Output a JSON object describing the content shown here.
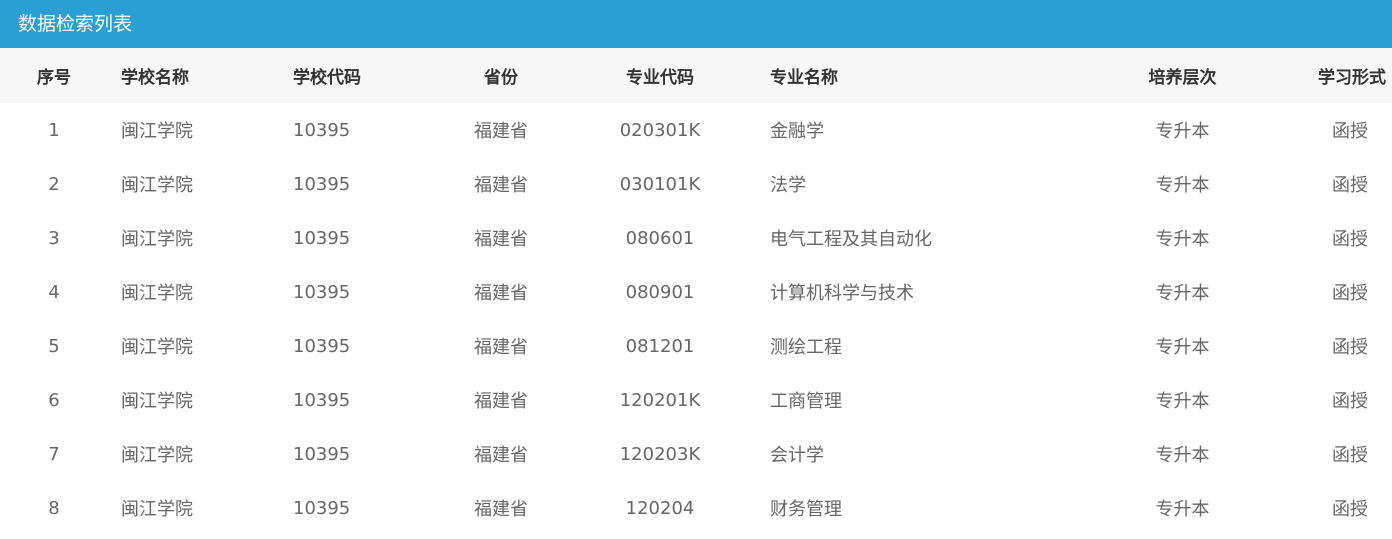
{
  "panel": {
    "title": "数据检索列表"
  },
  "table": {
    "headers": {
      "index": "序号",
      "school_name": "学校名称",
      "school_code": "学校代码",
      "province": "省份",
      "major_code": "专业代码",
      "major_name": "专业名称",
      "level": "培养层次",
      "study_form": "学习形式"
    },
    "rows": [
      {
        "index": "1",
        "school_name": "闽江学院",
        "school_code": "10395",
        "province": "福建省",
        "major_code": "020301K",
        "major_name": "金融学",
        "level": "专升本",
        "study_form": "函授"
      },
      {
        "index": "2",
        "school_name": "闽江学院",
        "school_code": "10395",
        "province": "福建省",
        "major_code": "030101K",
        "major_name": "法学",
        "level": "专升本",
        "study_form": "函授"
      },
      {
        "index": "3",
        "school_name": "闽江学院",
        "school_code": "10395",
        "province": "福建省",
        "major_code": "080601",
        "major_name": "电气工程及其自动化",
        "level": "专升本",
        "study_form": "函授"
      },
      {
        "index": "4",
        "school_name": "闽江学院",
        "school_code": "10395",
        "province": "福建省",
        "major_code": "080901",
        "major_name": "计算机科学与技术",
        "level": "专升本",
        "study_form": "函授"
      },
      {
        "index": "5",
        "school_name": "闽江学院",
        "school_code": "10395",
        "province": "福建省",
        "major_code": "081201",
        "major_name": "测绘工程",
        "level": "专升本",
        "study_form": "函授"
      },
      {
        "index": "6",
        "school_name": "闽江学院",
        "school_code": "10395",
        "province": "福建省",
        "major_code": "120201K",
        "major_name": "工商管理",
        "level": "专升本",
        "study_form": "函授"
      },
      {
        "index": "7",
        "school_name": "闽江学院",
        "school_code": "10395",
        "province": "福建省",
        "major_code": "120203K",
        "major_name": "会计学",
        "level": "专升本",
        "study_form": "函授"
      },
      {
        "index": "8",
        "school_name": "闽江学院",
        "school_code": "10395",
        "province": "福建省",
        "major_code": "120204",
        "major_name": "财务管理",
        "level": "专升本",
        "study_form": "函授"
      }
    ]
  }
}
